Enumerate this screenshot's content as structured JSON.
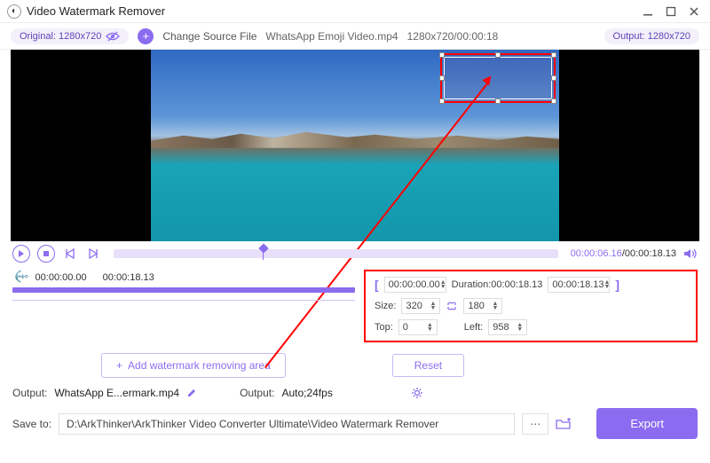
{
  "window": {
    "title": "Video Watermark Remover"
  },
  "toolbar": {
    "original_label": "Original: 1280x720",
    "change_source": "Change Source File",
    "filename": "WhatsApp Emoji Video.mp4",
    "video_info": "1280x720/00:00:18",
    "output_label": "Output: 1280x720"
  },
  "playback": {
    "current": "00:00:06.16",
    "duration": "00:00:18.13"
  },
  "segment": {
    "start": "00:00:00.00",
    "end": "00:00:18.13"
  },
  "range": {
    "start": "00:00:00.00",
    "duration_label": "Duration:00:00:18.13",
    "end": "00:00:18.13"
  },
  "size": {
    "label": "Size:",
    "width": "320",
    "height": "180"
  },
  "position": {
    "top_label": "Top:",
    "top": "0",
    "left_label": "Left:",
    "left": "958"
  },
  "actions": {
    "add_area": "Add watermark removing area",
    "reset": "Reset"
  },
  "output": {
    "label1": "Output:",
    "filename": "WhatsApp E...ermark.mp4",
    "label2": "Output:",
    "format": "Auto;24fps"
  },
  "save": {
    "label": "Save to:",
    "path": "D:\\ArkThinker\\ArkThinker Video Converter Ultimate\\Video Watermark Remover",
    "export": "Export"
  }
}
